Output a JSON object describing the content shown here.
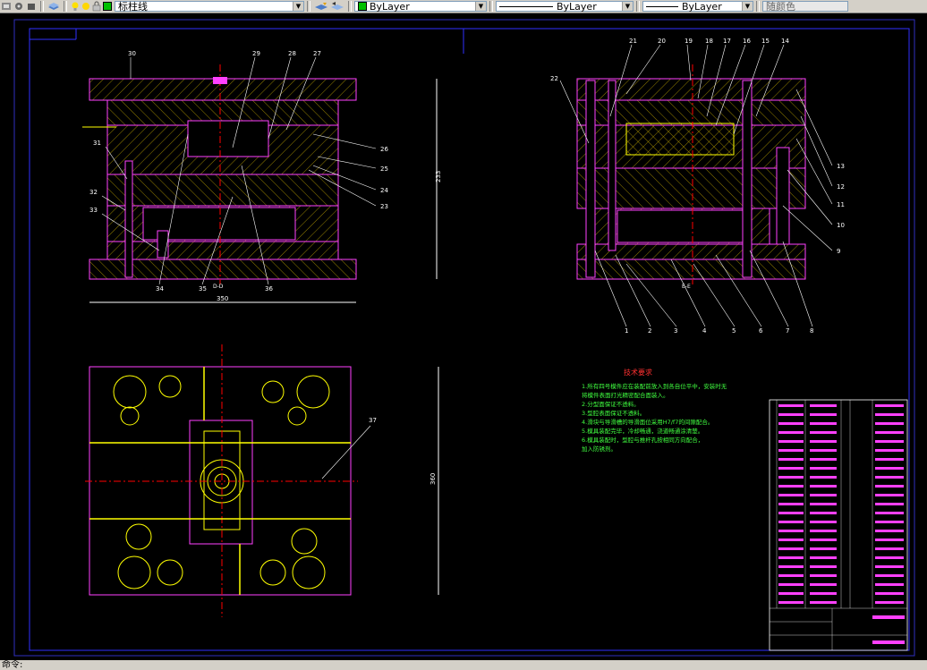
{
  "toolbar": {
    "layer_name": "标柱线",
    "color_value": "ByLayer",
    "linetype_value": "ByLayer",
    "lineweight_value": "ByLayer",
    "plotstyle_value": "随颜色",
    "colors": {
      "layer_swatch": "#00c000",
      "color_swatch": "#00c000"
    }
  },
  "drawing": {
    "top_left_labels": [
      "30",
      "29",
      "28",
      "27",
      "26",
      "25",
      "24",
      "23",
      "31",
      "32",
      "33",
      "34",
      "35",
      "36"
    ],
    "top_left_dim_height": "233",
    "top_left_dim_width": "350",
    "top_left_section": "D-D",
    "top_right_labels": [
      "22",
      "21",
      "20",
      "19",
      "18",
      "17",
      "16",
      "15",
      "14",
      "13",
      "12",
      "11",
      "10",
      "9",
      "1",
      "2",
      "3",
      "4",
      "5",
      "6",
      "7",
      "8"
    ],
    "top_right_section": "E-E",
    "plan_label": "37",
    "plan_dim": "360",
    "tech_title": "技术要求",
    "tech_items": [
      "1.所有四号模件应在装配前放入到各自位平中，安装时无",
      "   将模件表面打光精密配合面装入。",
      "2.分型面保证不透料。",
      "3.型腔表面保证不透料。",
      "4.滑块与导滑槽的导滑面位采用H7/f7的间隙配合。",
      "5.模具装配完毕，冷却畅通，浇道畅通涂清楚。",
      "6.模具装配时，型腔与推杆孔按相同方向配合，",
      "   加入防锈剂。"
    ]
  },
  "status": {
    "prompt": "命令:"
  }
}
